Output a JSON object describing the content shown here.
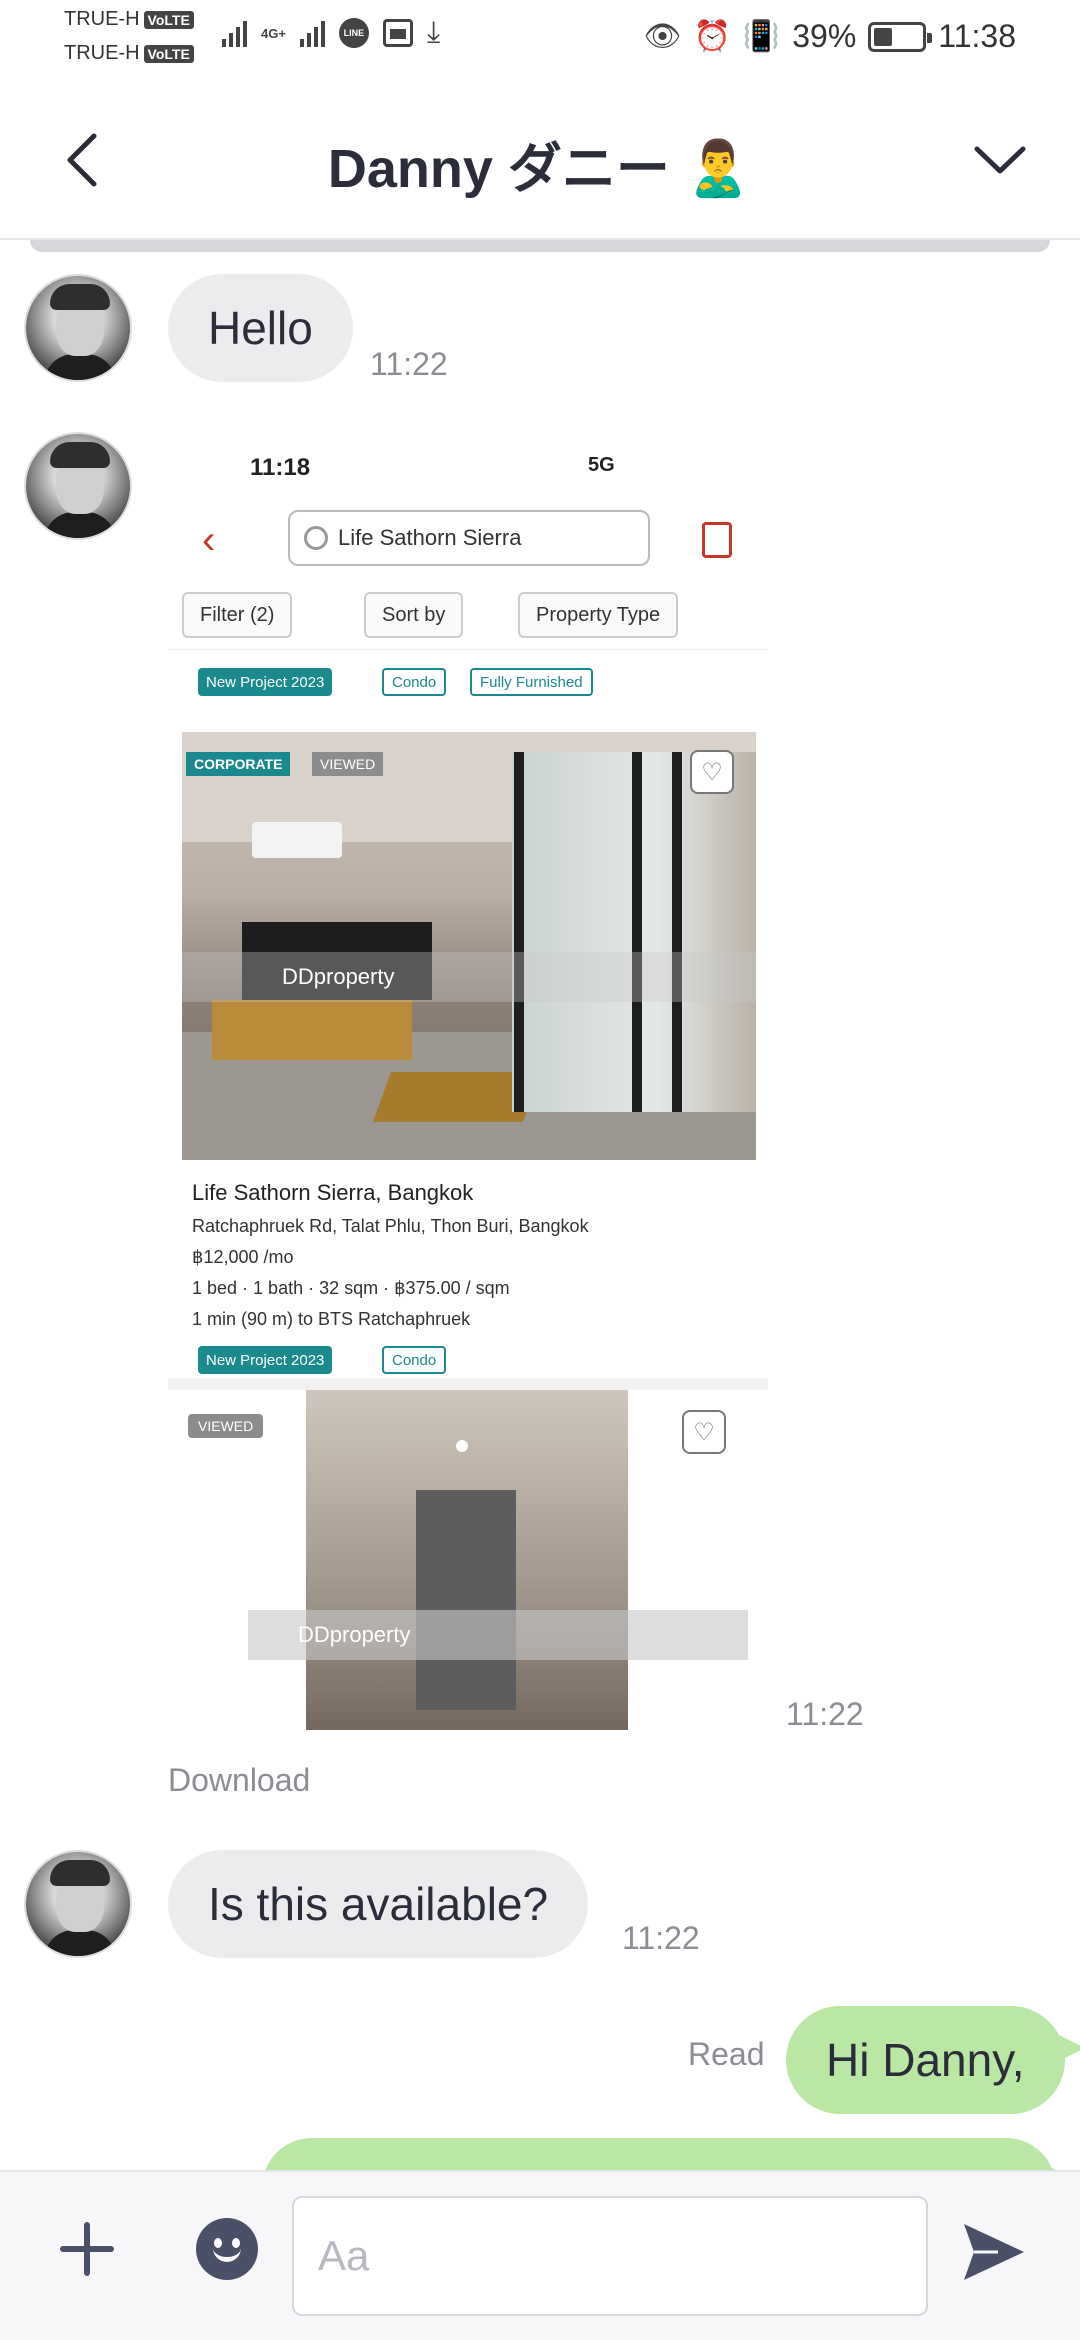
{
  "status_bar": {
    "carrier_1": "TRUE-H",
    "carrier_2": "TRUE-H",
    "volte_label": "VoLTE",
    "network_label": "4G+",
    "line_badge": "LINE",
    "battery_percent": "39%",
    "battery_level": 0.39,
    "time": "11:38"
  },
  "header": {
    "title": "Danny ダニー 🙎‍♂️",
    "back_icon": "chevron-left-icon",
    "menu_icon": "chevron-down-icon"
  },
  "messages": {
    "m1": {
      "text": "Hello",
      "time": "11:22"
    },
    "m2": {
      "time": "11:22",
      "download_label": "Download"
    },
    "m3": {
      "text": "Is this available?",
      "time": "11:22"
    },
    "m4": {
      "text": "Hi Danny,",
      "status": "Read"
    }
  },
  "shared_image": {
    "status_time": "11:18",
    "status_right": "5G",
    "search_text": "Life Sathorn Sierra",
    "chips": [
      "Filter (2)",
      "Sort by",
      "Property Type"
    ],
    "tag_row_1": [
      "New Project 2023",
      "Condo",
      "Fully Furnished"
    ],
    "badge_corporate": "CORPORATE",
    "badge_viewed": "VIEWED",
    "watermark": "DDproperty",
    "listing_name": "Life Sathorn Sierra, Bangkok",
    "listing_address": "Ratchaphruek Rd, Talat Phlu, Thon Buri, Bangkok",
    "listing_price": "฿12,000 /mo",
    "listing_specs": "1 bed · 1 bath · 32 sqm · ฿375.00 / sqm",
    "listing_transit": "1 min (90 m) to BTS Ratchaphruek",
    "tag_row_2": [
      "New Project 2023",
      "Condo"
    ],
    "card2_viewed": "VIEWED"
  },
  "input_bar": {
    "placeholder": "Aa",
    "plus_icon": "plus-icon",
    "emoji_icon": "emoji-icon",
    "send_icon": "send-icon"
  },
  "colors": {
    "incoming_bubble": "#ececef",
    "outgoing_bubble": "#b9e7a4",
    "accent": "#4a5068",
    "timestamp": "#8b8d95"
  }
}
